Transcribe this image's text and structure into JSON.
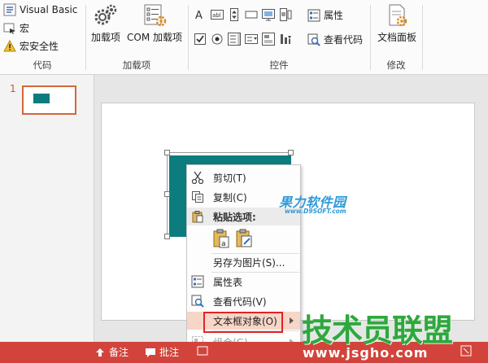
{
  "ribbon": {
    "code_group": {
      "label": "代码",
      "visual_basic": "Visual Basic",
      "macros": "宏",
      "macro_security": "宏安全性"
    },
    "addins_group": {
      "label": "加载项",
      "addins": "加载项",
      "com_addins": "COM 加载项"
    },
    "controls_group": {
      "label": "控件",
      "properties": "属性",
      "view_code": "查看代码"
    },
    "modify_group": {
      "label": "修改",
      "document_panel": "文档面板"
    }
  },
  "thumbnails": {
    "slide_number": "1"
  },
  "context_menu": {
    "cut": "剪切(T)",
    "copy": "复制(C)",
    "paste_options": "粘贴选项:",
    "save_as_picture": "另存为图片(S)...",
    "property_sheet": "属性表",
    "view_code": "查看代码(V)",
    "textbox_object": "文本框对象(O)",
    "group": "组合(G)"
  },
  "status_bar": {
    "notes": "备注",
    "comments": "批注"
  },
  "watermarks": {
    "site1": "果力软件园",
    "site1_url": "www.D9SOFT.com",
    "site2": "技术员联盟",
    "site2_url": "www.jsgho.com"
  },
  "colors": {
    "shape_fill": "#0c7c7e",
    "accent": "#d2443b",
    "highlight": "#f7d5c7"
  }
}
